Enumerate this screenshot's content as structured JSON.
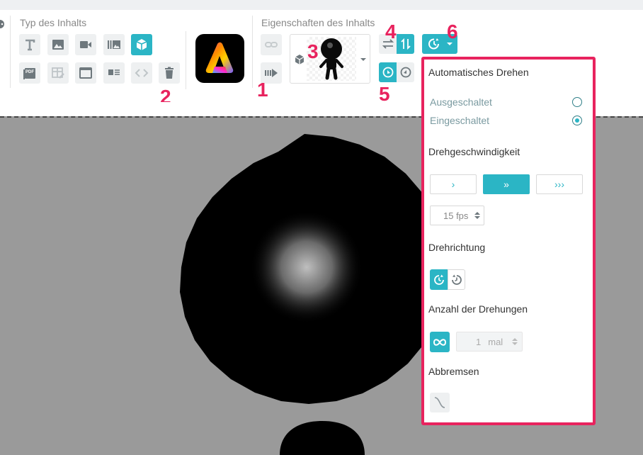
{
  "toolbar": {
    "content_type_label": "Typ des Inhalts",
    "content_props_label": "Eigenschaften des Inhalts",
    "tools_row1": [
      "text-icon",
      "image-icon",
      "video-icon",
      "gallery-icon",
      "3d-cube-icon"
    ],
    "tools_row2": [
      "pdf-icon",
      "table-edit-icon",
      "window-icon",
      "card-icon",
      "code-icon",
      "trash-icon"
    ],
    "app_logo": "adobe-express-logo",
    "pdf_icon_text": "PDF"
  },
  "callouts": [
    "1",
    "2",
    "3",
    "4",
    "5",
    "6"
  ],
  "panel": {
    "auto_rotate_title": "Automatisches Drehen",
    "option_off": "Ausgeschaltet",
    "option_on": "Eingeschaltet",
    "selected_option": "Eingeschaltet",
    "speed_title": "Drehgeschwindigkeit",
    "speed_options": [
      "›",
      "»",
      "›››"
    ],
    "selected_speed": 1,
    "fps_value": "15 fps",
    "direction_title": "Drehrichtung",
    "rotations_title": "Anzahl der Drehungen",
    "rotations_value": "1",
    "rotations_unit": "mal",
    "brake_title": "Abbremsen"
  },
  "colors": {
    "accent": "#2bb5c5",
    "highlight": "#e8235e",
    "canvas_bg": "#9a9a9a"
  }
}
